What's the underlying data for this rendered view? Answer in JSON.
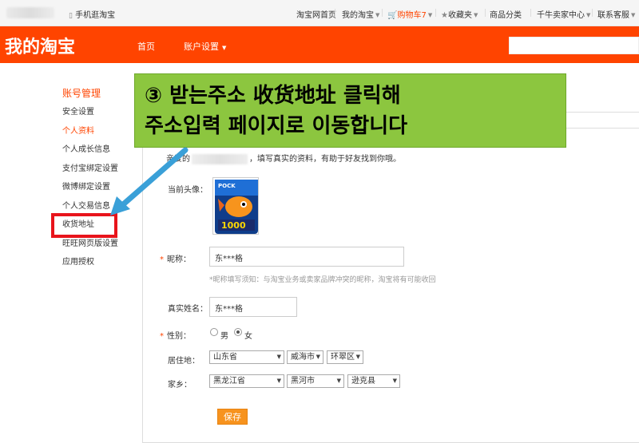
{
  "topbar": {
    "items": [
      "手机逛淘宝",
      "淘宝网首页",
      "我的淘宝",
      "购物车7",
      "收藏夹",
      "商品分类",
      "千牛卖家中心",
      "联系客服"
    ],
    "accent": "#ff4400"
  },
  "header": {
    "logo": "我的淘宝",
    "nav_home": "首页",
    "nav_account": "账户设置"
  },
  "sidebar": {
    "title": "账号管理",
    "items": [
      {
        "label": "安全设置",
        "active": false
      },
      {
        "label": "个人资料",
        "active": true
      },
      {
        "label": "个人成长信息",
        "active": false
      },
      {
        "label": "支付宝绑定设置",
        "active": false
      },
      {
        "label": "微博绑定设置",
        "active": false
      },
      {
        "label": "个人交易信息",
        "active": false
      },
      {
        "label": "收货地址",
        "active": false,
        "highlighted": true
      },
      {
        "label": "旺旺网页版设置",
        "active": false
      },
      {
        "label": "应用授权",
        "active": false
      }
    ]
  },
  "form": {
    "intro_prefix": "亲爱的",
    "intro_suffix": "，填写真实的资料，有助于好友找到你哦。",
    "avatar_label": "当前头像：",
    "nickname_label": "昵称：",
    "nickname_value": "东***格",
    "nickname_hint": "*昵称填写须知：与淘宝业务或卖家品牌冲突的昵称，淘宝将有可能收回",
    "realname_label": "真实姓名：",
    "realname_value": "东***格",
    "gender_label": "性别：",
    "gender_male": "男",
    "gender_female": "女",
    "gender_selected": "女",
    "residence_label": "居住地：",
    "residence": [
      "山东省",
      "威海市",
      "环翠区"
    ],
    "hometown_label": "家乡：",
    "hometown": [
      "黑龙江省",
      "黑河市",
      "逊克县"
    ],
    "save_label": "保存"
  },
  "annotation": {
    "line1": "③ 받는주소 收货地址 클릭해",
    "line2": "주소입력 페이지로 이동합니다",
    "background": "#8cc63f",
    "arrow_color": "#3aa0d8",
    "box_color": "#e8141b"
  }
}
